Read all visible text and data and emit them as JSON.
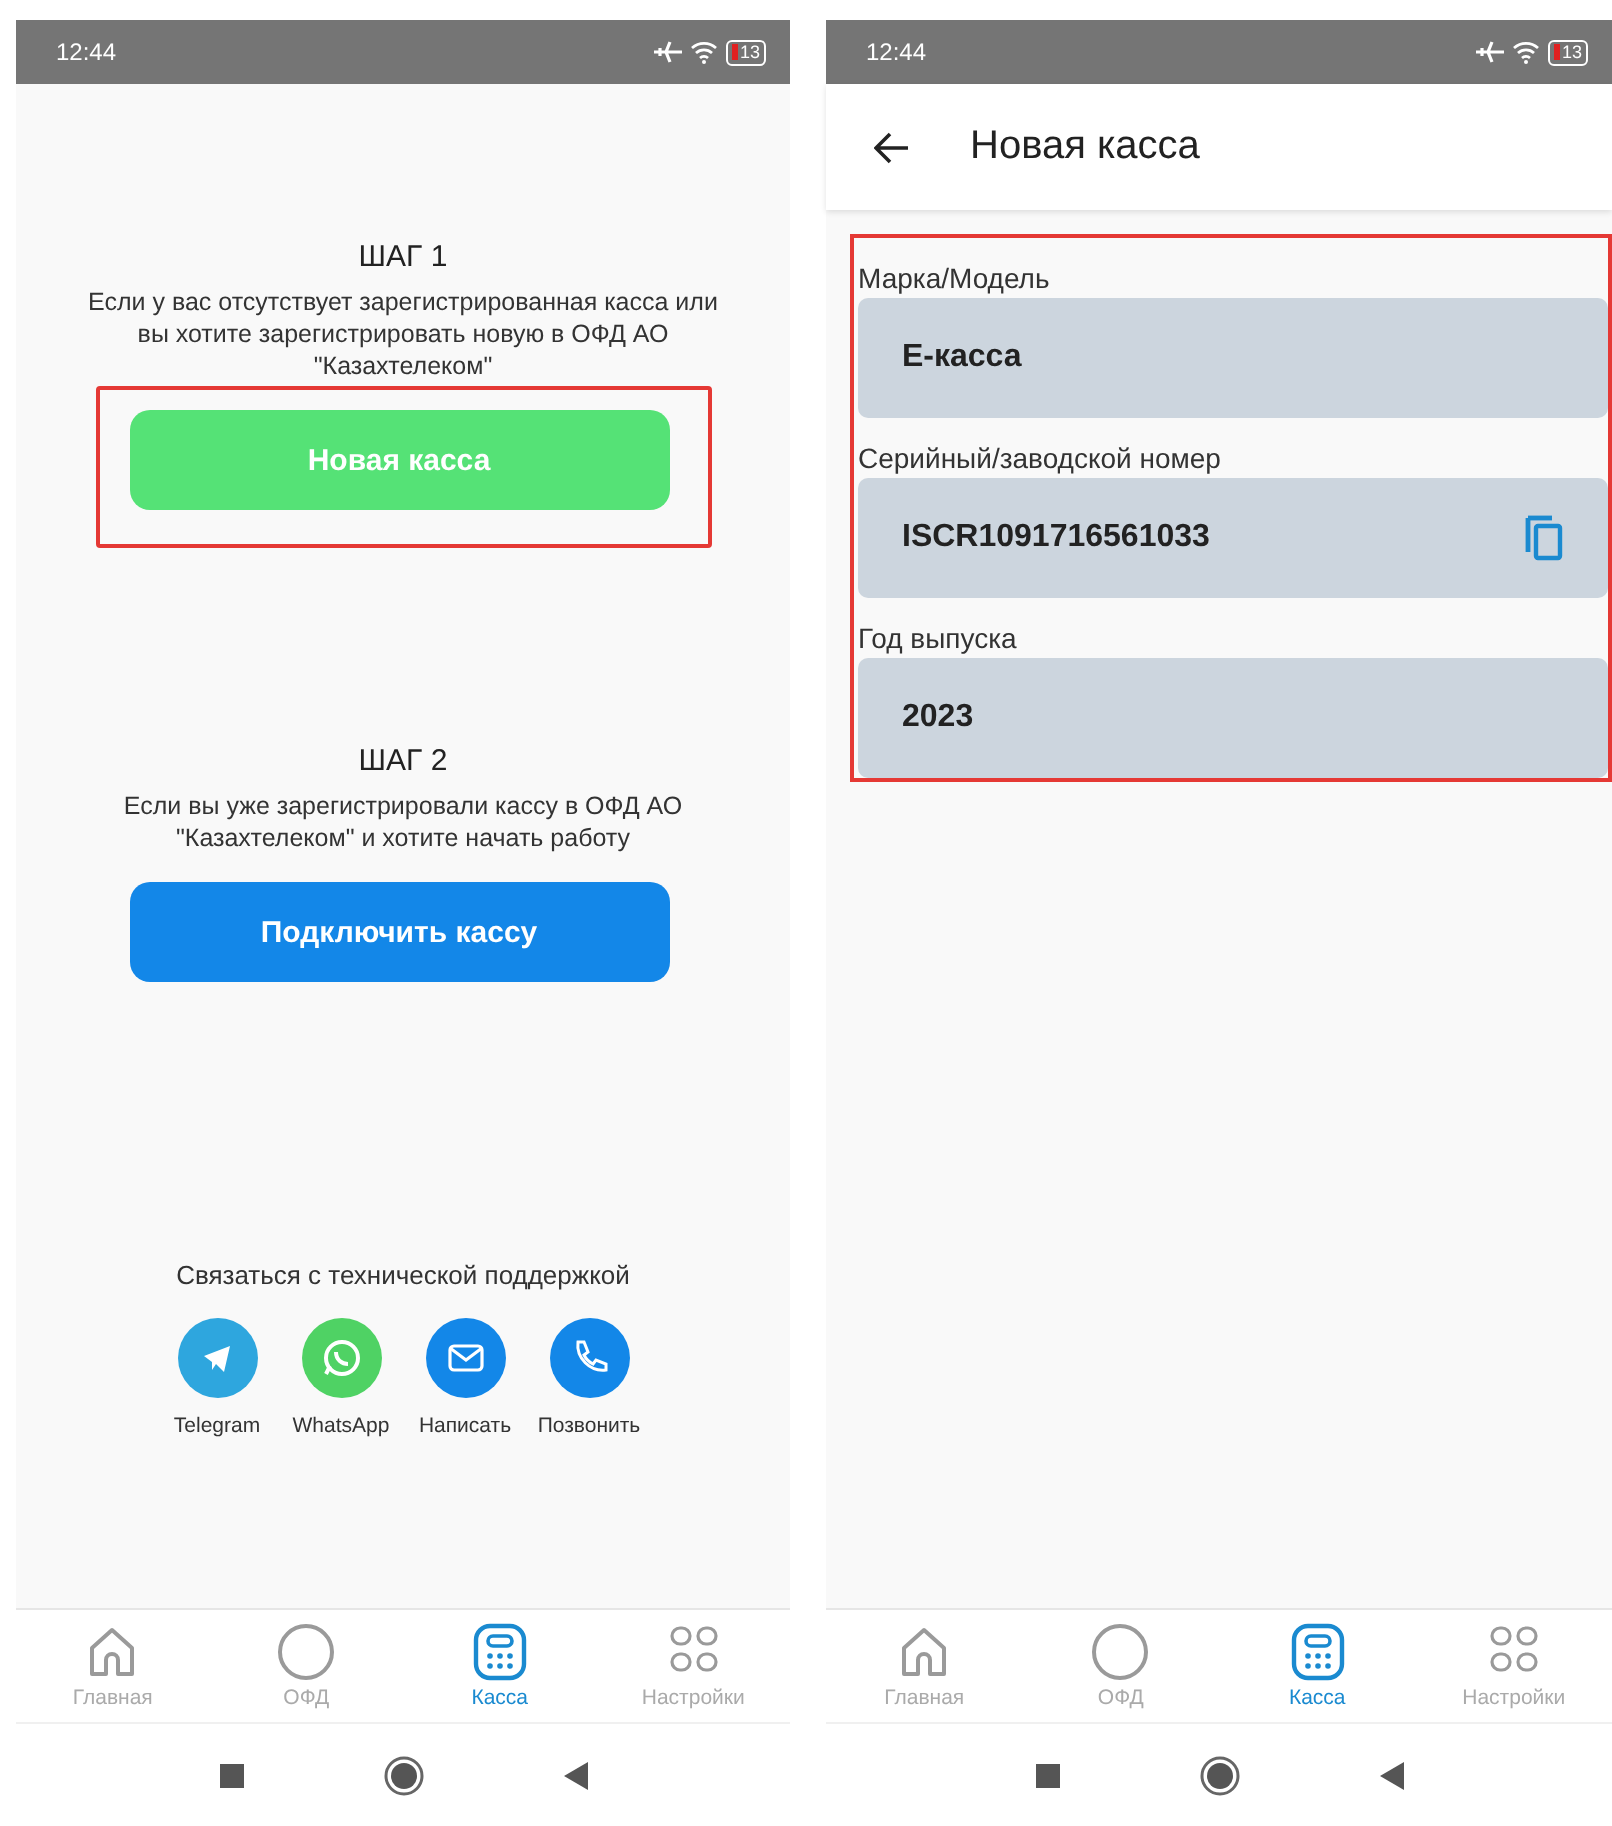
{
  "screens": [
    {
      "kind": "start",
      "status_bar": {
        "time": "12:44",
        "battery": "13"
      },
      "steps": [
        {
          "title": "ШАГ 1",
          "description": "Если у вас отсутствует зарегистрированная касса или вы хотите зарегистрировать новую в ОФД АО \"Казахтелеком\"",
          "button": "Новая касса",
          "color": "#55e276",
          "highlighted": true
        },
        {
          "title": "ШАГ 2",
          "description": "Если вы уже зарегистрировали кассу в ОФД АО \"Казахтелеком\" и хотите начать работу",
          "button": "Подключить кассу",
          "color": "#1387e8",
          "highlighted": false
        }
      ],
      "support": {
        "title": "Связаться с технической поддержкой",
        "contacts": [
          {
            "kind": "telegram",
            "label": "Telegram",
            "color": "#2ea6de"
          },
          {
            "kind": "whatsapp",
            "label": "WhatsApp",
            "color": "#4fd264"
          },
          {
            "kind": "mail",
            "label": "Написать",
            "color": "#1387e8"
          },
          {
            "kind": "phone",
            "label": "Позвонить",
            "color": "#1387e8"
          }
        ]
      },
      "tab_bar": [
        {
          "kind": "home",
          "label": "Главная",
          "selected": false
        },
        {
          "kind": "circle",
          "label": "ОФД",
          "selected": false
        },
        {
          "kind": "register",
          "label": "Касса",
          "selected": true
        },
        {
          "kind": "grid",
          "label": "Настройки",
          "selected": false
        }
      ]
    },
    {
      "kind": "form",
      "status_bar": {
        "time": "12:44",
        "battery": "13"
      },
      "header": {
        "title": "Новая касса"
      },
      "form": {
        "highlighted": true,
        "fields": [
          {
            "label": "Марка/Модель",
            "value": "Е-касса",
            "copy_button": false
          },
          {
            "label": "Серийный/заводской номер",
            "value": "ISCR1091716561033",
            "copy_button": true
          },
          {
            "label": "Год выпуска",
            "value": "2023",
            "copy_button": false
          }
        ]
      },
      "tab_bar": [
        {
          "kind": "home",
          "label": "Главная",
          "selected": false
        },
        {
          "kind": "circle",
          "label": "ОФД",
          "selected": false
        },
        {
          "kind": "register",
          "label": "Касса",
          "selected": true
        },
        {
          "kind": "grid",
          "label": "Настройки",
          "selected": false
        }
      ]
    }
  ]
}
